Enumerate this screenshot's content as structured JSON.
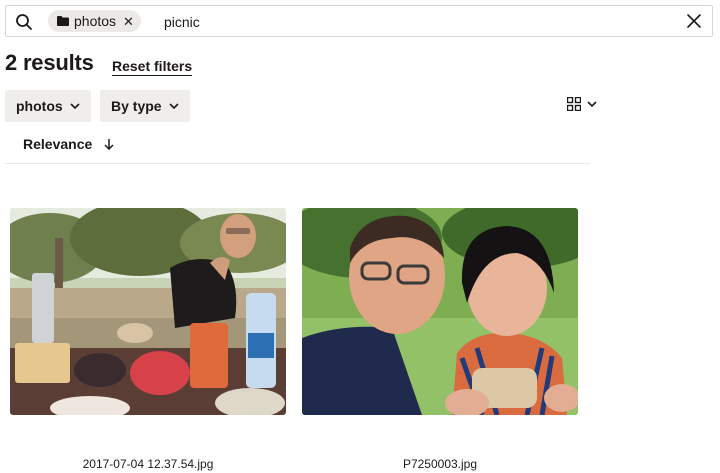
{
  "search": {
    "chip_label": "photos",
    "query": "picnic",
    "placeholder": ""
  },
  "results": {
    "count_label": "2 results",
    "reset_label": "Reset filters"
  },
  "filters": [
    {
      "label": "photos"
    },
    {
      "label": "By type"
    }
  ],
  "sort": {
    "label": "Relevance"
  },
  "files": [
    {
      "name": "2017-07-04 12.37.54.jpg"
    },
    {
      "name": "P7250003.jpg"
    }
  ],
  "icons": {
    "search": "search-icon",
    "folder": "folder-icon",
    "remove": "close-icon",
    "clear": "close-icon",
    "chevron": "chevron-down-icon",
    "grid": "grid-view-icon",
    "sort": "arrow-down-icon"
  },
  "colors": {
    "text": "#1e1919",
    "chip_bg": "#eceae6",
    "filter_bg": "#f0eeeb",
    "border": "#d9d6d2"
  }
}
